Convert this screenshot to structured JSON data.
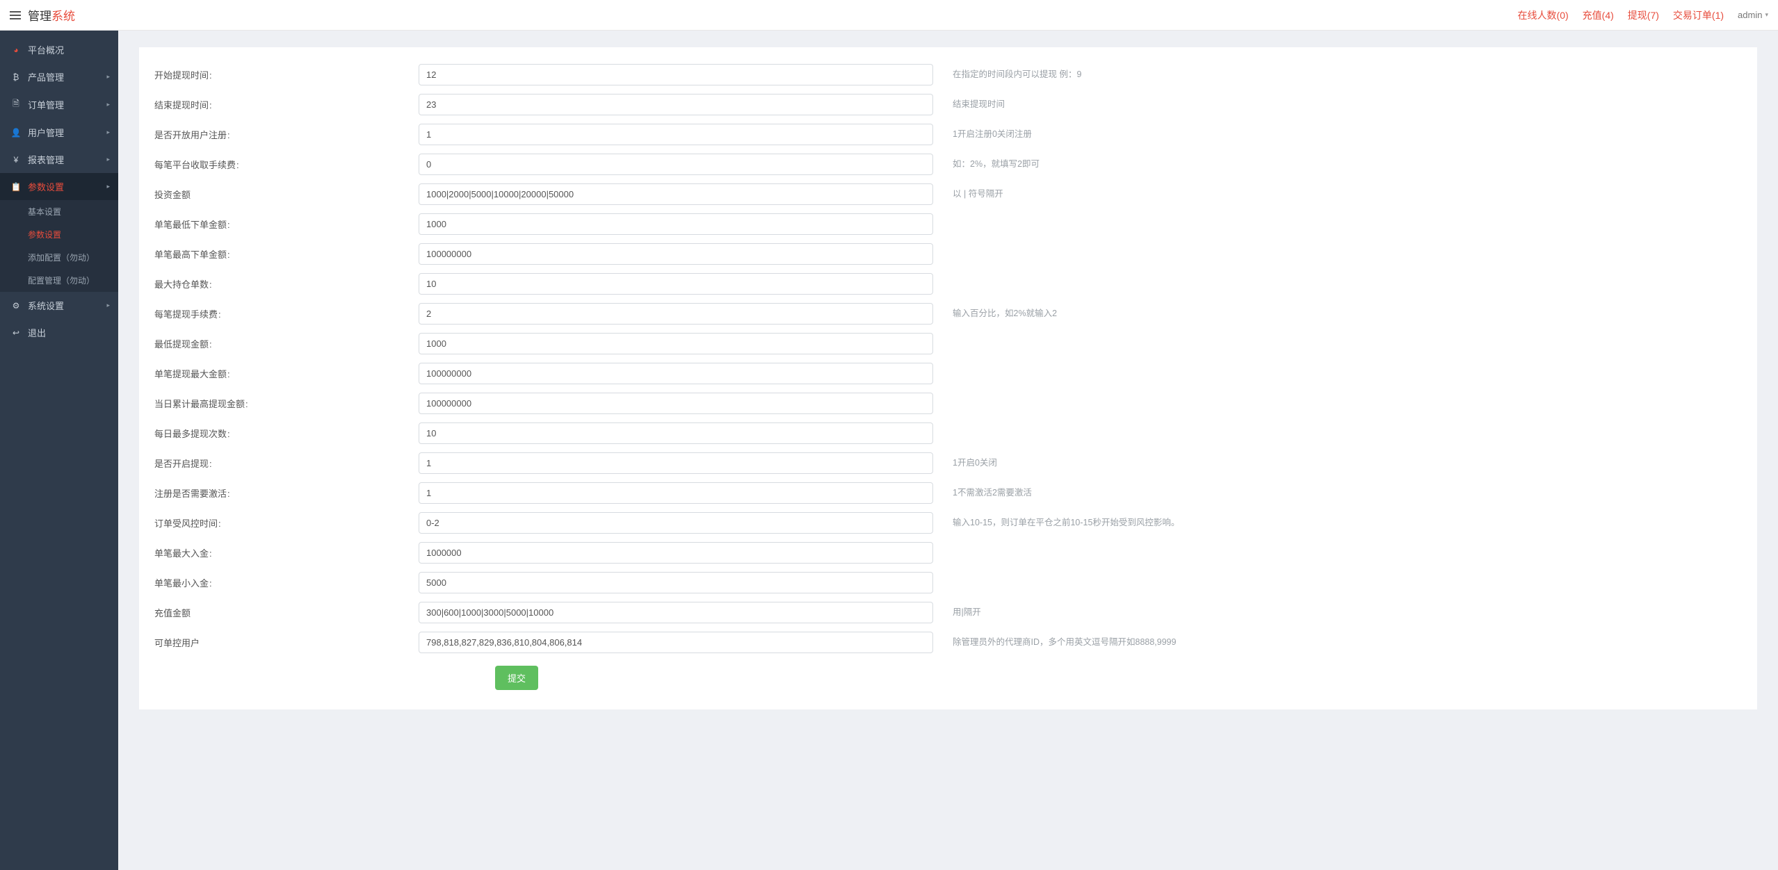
{
  "header": {
    "brand1": "管理",
    "brand2": "系统",
    "links": [
      "在线人数(0)",
      "充值(4)",
      "提现(7)",
      "交易订单(1)"
    ],
    "admin": "admin"
  },
  "sidebar": {
    "items": [
      {
        "label": "平台概况",
        "icon": "dashboard",
        "expandable": false,
        "iconColor": "red"
      },
      {
        "label": "产品管理",
        "icon": "bitcoin",
        "expandable": true
      },
      {
        "label": "订单管理",
        "icon": "doc",
        "expandable": true
      },
      {
        "label": "用户管理",
        "icon": "user",
        "expandable": true
      },
      {
        "label": "报表管理",
        "icon": "yen",
        "expandable": true
      },
      {
        "label": "参数设置",
        "icon": "clipboard",
        "expandable": true,
        "active": true,
        "iconColor": "red",
        "children": [
          {
            "label": "基本设置"
          },
          {
            "label": "参数设置",
            "active": true
          },
          {
            "label": "添加配置（勿动）"
          },
          {
            "label": "配置管理（勿动）"
          }
        ]
      },
      {
        "label": "系统设置",
        "icon": "gear",
        "expandable": true
      },
      {
        "label": "退出",
        "icon": "exit",
        "expandable": false
      }
    ]
  },
  "form": {
    "rows": [
      {
        "label": "开始提现时间",
        "value": "12",
        "help": "在指定的时间段内可以提现 例：9"
      },
      {
        "label": "结束提现时间",
        "value": "23",
        "help": "结束提现时间"
      },
      {
        "label": "是否开放用户注册",
        "value": "1",
        "help": "1开启注册0关闭注册"
      },
      {
        "label": "每笔平台收取手续费",
        "value": "0",
        "help": "如：2%，就填写2即可"
      },
      {
        "label": "投资金额",
        "value": "1000|2000|5000|10000|20000|50000",
        "help": "以 | 符号隔开",
        "noColon": true
      },
      {
        "label": "单笔最低下单金额",
        "value": "1000",
        "help": ""
      },
      {
        "label": "单笔最高下单金额",
        "value": "100000000",
        "help": ""
      },
      {
        "label": "最大持仓单数",
        "value": "10",
        "help": ""
      },
      {
        "label": "每笔提现手续费",
        "value": "2",
        "help": "输入百分比，如2%就输入2"
      },
      {
        "label": "最低提现金额",
        "value": "1000",
        "help": ""
      },
      {
        "label": "单笔提现最大金额",
        "value": "100000000",
        "help": ""
      },
      {
        "label": "当日累计最高提现金额",
        "value": "100000000",
        "help": ""
      },
      {
        "label": "每日最多提现次数",
        "value": "10",
        "help": ""
      },
      {
        "label": "是否开启提现",
        "value": "1",
        "help": "1开启0关闭"
      },
      {
        "label": "注册是否需要激活",
        "value": "1",
        "help": "1不需激活2需要激活"
      },
      {
        "label": "订单受风控时间",
        "value": "0-2",
        "help": "输入10-15，则订单在平仓之前10-15秒开始受到风控影响。"
      },
      {
        "label": "单笔最大入金",
        "value": "1000000",
        "help": ""
      },
      {
        "label": "单笔最小入金",
        "value": "5000",
        "help": ""
      },
      {
        "label": "充值金额",
        "value": "300|600|1000|3000|5000|10000",
        "help": "用|隔开",
        "noColon": true
      },
      {
        "label": "可单控用户",
        "value": "798,818,827,829,836,810,804,806,814",
        "help": "除管理员外的代理商ID，多个用英文逗号隔开如8888,9999",
        "noColon": true
      }
    ],
    "submit": "提交"
  }
}
